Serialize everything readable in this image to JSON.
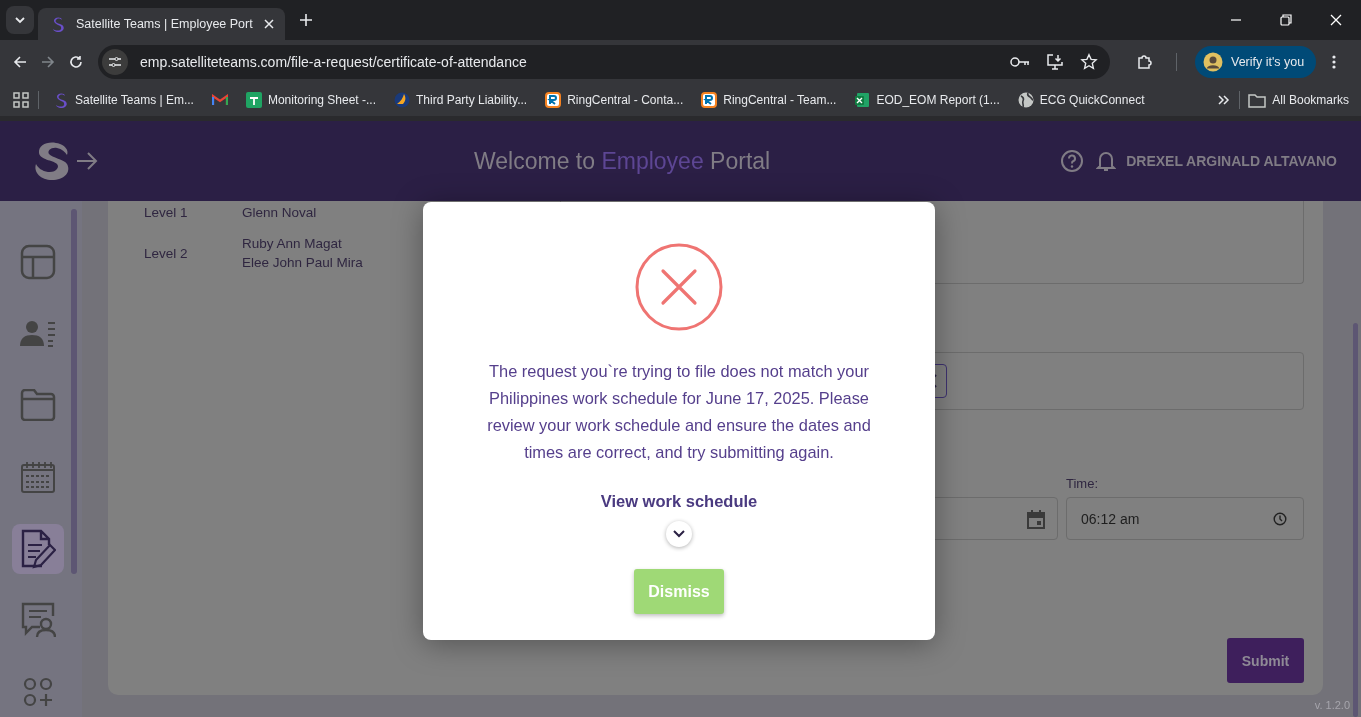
{
  "browser": {
    "tab": {
      "title": "Satellite Teams | Employee Port",
      "selected": true
    },
    "url": "emp.satelliteteams.com/file-a-request/certificate-of-attendance",
    "profile_button": "Verify it's you",
    "bookmarks": [
      {
        "kind": "satellite",
        "label": "Satellite Teams | Em..."
      },
      {
        "kind": "gmail"
      },
      {
        "kind": "sheet",
        "label": "Monitoring Sheet -..."
      },
      {
        "kind": "swoosh",
        "label": "Third Party Liability..."
      },
      {
        "kind": "ringcentral",
        "label": "RingCentral - Conta..."
      },
      {
        "kind": "ringcentral",
        "label": "RingCentral - Team..."
      },
      {
        "kind": "excel",
        "label": "EOD_EOM Report (1..."
      },
      {
        "kind": "globe",
        "label": "ECG QuickConnect"
      }
    ],
    "all_bookmarks": "All Bookmarks"
  },
  "header": {
    "title": [
      {
        "text": "Welcome to",
        "highlight": false
      },
      {
        "text": "Employee",
        "highlight": true
      },
      {
        "text": "Portal",
        "highlight": false
      }
    ],
    "user_name": "DREXEL ARGINALD ALTAVANO"
  },
  "sidebar": {
    "items": [
      {
        "kind": "layout",
        "selected": false
      },
      {
        "kind": "contact",
        "selected": false
      },
      {
        "kind": "folder",
        "selected": false
      },
      {
        "kind": "calendar",
        "selected": false
      },
      {
        "kind": "request",
        "selected": true
      },
      {
        "kind": "feedback",
        "selected": false
      },
      {
        "kind": "apps",
        "selected": false
      }
    ]
  },
  "approvers": [
    {
      "level": "Level 1",
      "names": [
        "Glenn Noval"
      ]
    },
    {
      "level": "Level 2",
      "names": [
        "Ruby Ann Magat",
        "Elee John Paul Mira"
      ]
    }
  ],
  "form": {
    "time_label": "Time:",
    "time_value": "06:12 am",
    "submit": "Submit"
  },
  "version": "v. 1.2.0",
  "modal": {
    "message": "The request you`re trying to file does not match your Philippines work schedule for June 17, 2025. Please review your work schedule and ensure the dates and times are correct, and try submitting again.",
    "link": "View work schedule",
    "expanded": false,
    "dismiss": "Dismiss"
  }
}
